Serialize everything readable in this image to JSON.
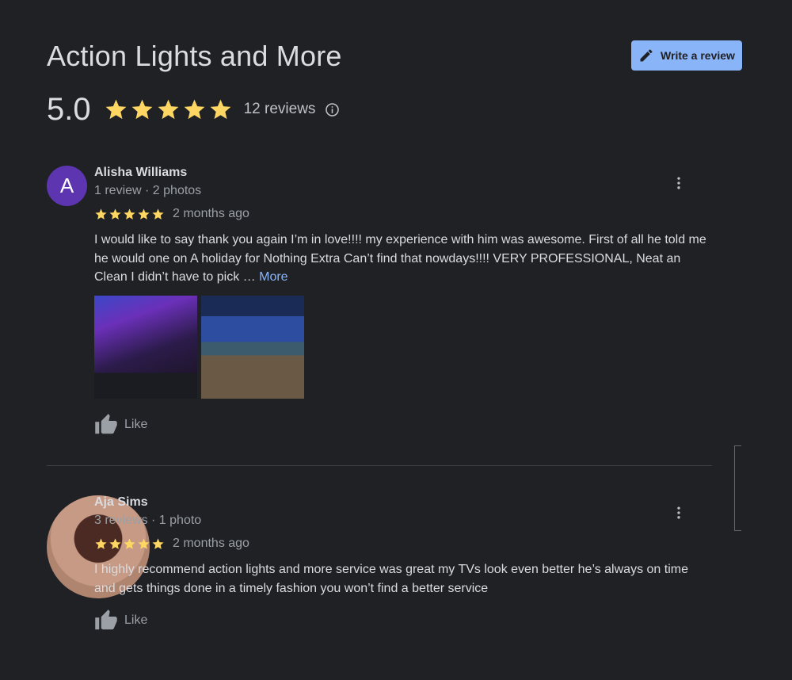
{
  "header": {
    "title": "Action Lights and More",
    "write_review_label": "Write a review",
    "rating": "5.0",
    "stars": 5,
    "review_count": "12 reviews"
  },
  "reviews": [
    {
      "name": "Alisha Williams",
      "avatar_letter": "A",
      "meta": "1 review · 2 photos",
      "stars": 5,
      "date": "2 months ago",
      "text": "I would like to say thank you again I’m in love!!!! my experience with him was awesome. First of all he told me he would one on A holiday for Nothing Extra Can’t find that nowdays!!!!  VERY PROFESSIONAL, Neat an Clean I didn’t have to pick … ",
      "more_label": "More",
      "like_label": "Like"
    },
    {
      "name": "Aja Sims",
      "meta": "3 reviews · 1 photo",
      "stars": 5,
      "date": "2 months ago",
      "text": "I highly recommend action lights and more service was great my TVs look even better he’s always on time and gets things done in a timely fashion you won’t find a better service",
      "like_label": "Like"
    }
  ],
  "colors": {
    "background": "#202124",
    "star": "#fdd663",
    "accent": "#8ab4f8",
    "avatar": "#5e35b1"
  },
  "icons": [
    "pencil-icon",
    "star-icon",
    "info-icon",
    "more-vert-icon",
    "thumb-up-icon"
  ]
}
